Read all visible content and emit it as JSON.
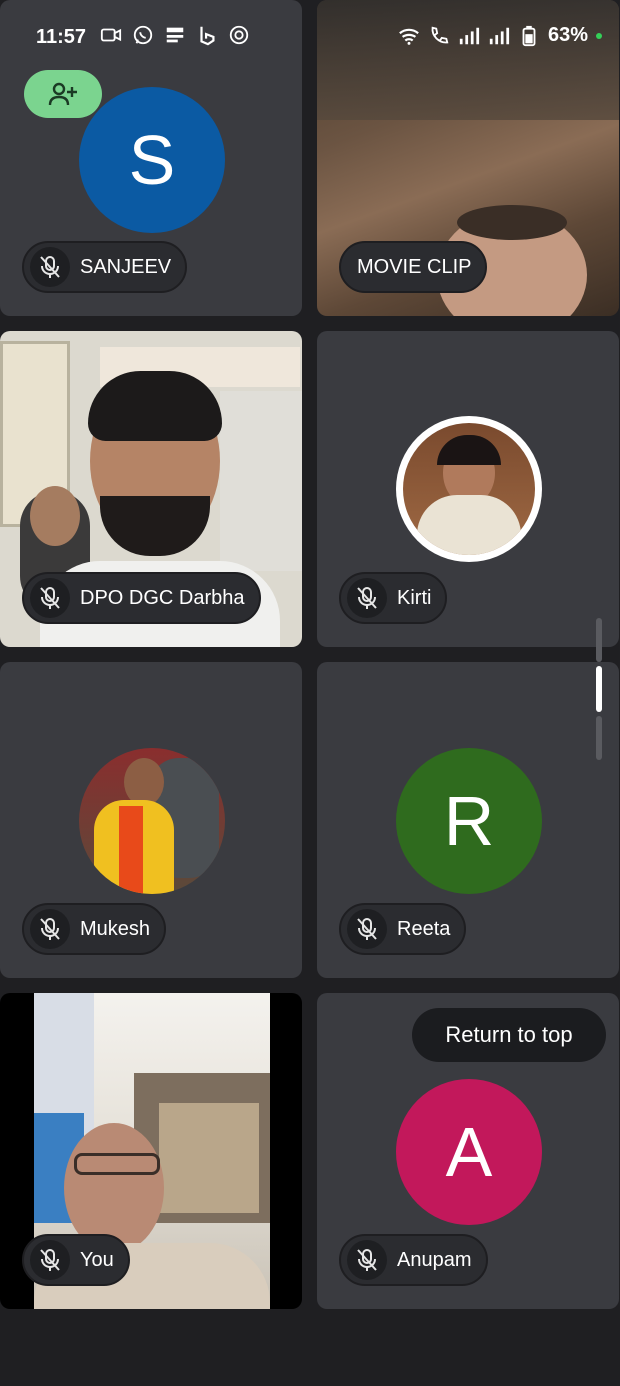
{
  "status_bar": {
    "time": "11:57",
    "battery": "63%",
    "left_icons": [
      "video-icon",
      "whatsapp-icon",
      "news-app-icon",
      "bing-icon",
      "signal-app-icon"
    ],
    "right_icons": [
      "wifi-icon",
      "volte-call-icon",
      "signal-bars-icon",
      "signal-bars-icon",
      "battery-icon"
    ]
  },
  "participants": [
    {
      "name": "SANJEEV",
      "initial": "S",
      "muted": true,
      "avatar_color": "#0b5aa3",
      "type": "initial-avatar"
    },
    {
      "name": "MOVIE CLIP",
      "muted": false,
      "type": "video"
    },
    {
      "name": "DPO DGC Darbha",
      "muted": true,
      "type": "video"
    },
    {
      "name": "Kirti",
      "muted": true,
      "type": "photo-avatar"
    },
    {
      "name": "Mukesh",
      "muted": true,
      "type": "photo-avatar"
    },
    {
      "name": "Reeta",
      "initial": "R",
      "muted": true,
      "avatar_color": "#2f6b1e",
      "type": "initial-avatar"
    },
    {
      "name": "You",
      "muted": true,
      "type": "video"
    },
    {
      "name": "Anupam",
      "initial": "A",
      "muted": true,
      "avatar_color": "#c2185b",
      "type": "initial-avatar"
    }
  ],
  "return_to_top": "Return to top",
  "colors": {
    "background": "#1f1f22",
    "tile": "#3a3b40",
    "add_button": "#7bd48f"
  }
}
